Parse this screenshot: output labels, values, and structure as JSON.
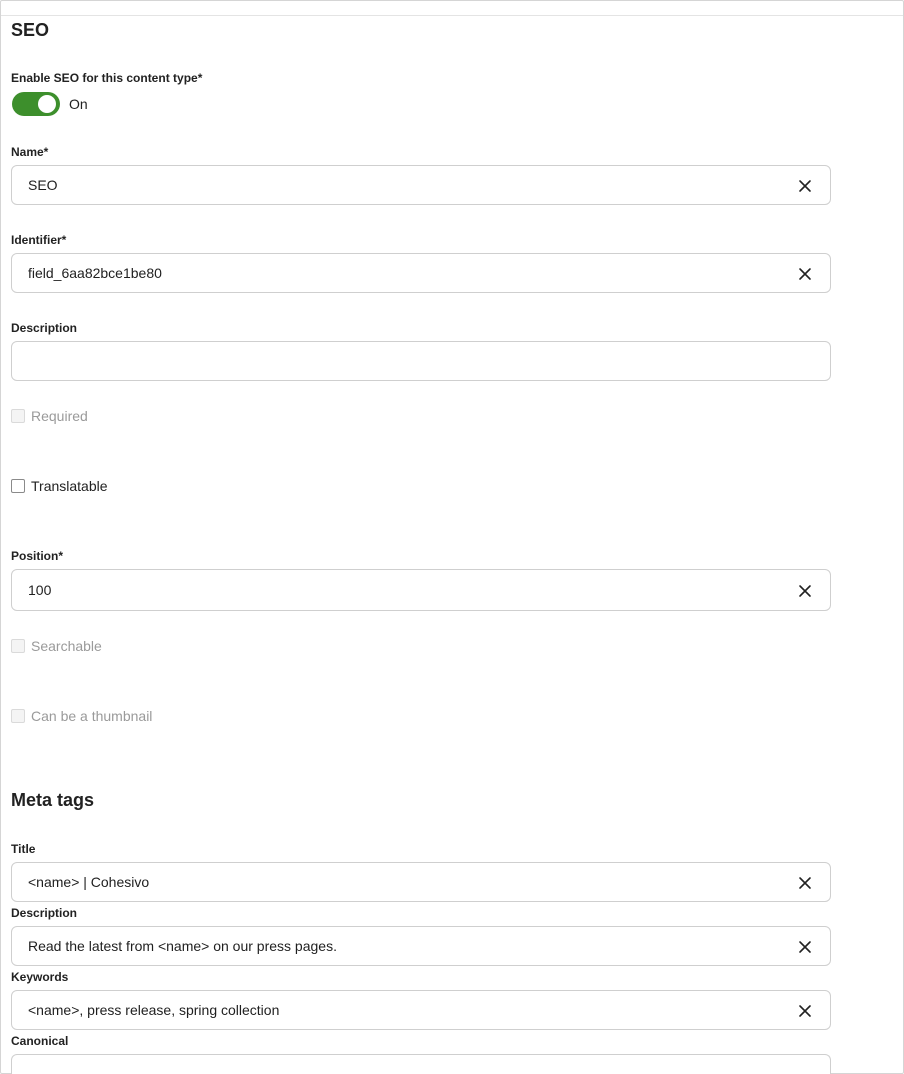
{
  "seo": {
    "title": "SEO",
    "enable_label": "Enable SEO for this content type*",
    "enable_state": "On"
  },
  "fields": {
    "name": {
      "label": "Name*",
      "value": "SEO"
    },
    "identifier": {
      "label": "Identifier*",
      "value": "field_6aa82bce1be80"
    },
    "description": {
      "label": "Description",
      "value": ""
    },
    "required": {
      "label": "Required",
      "checked": false,
      "disabled": true
    },
    "translatable": {
      "label": "Translatable",
      "checked": false,
      "disabled": false
    },
    "position": {
      "label": "Position*",
      "value": "100"
    },
    "searchable": {
      "label": "Searchable",
      "checked": false,
      "disabled": true
    },
    "thumbnail": {
      "label": "Can be a thumbnail",
      "checked": false,
      "disabled": true
    }
  },
  "meta": {
    "title": "Meta tags",
    "title_field": {
      "label": "Title",
      "value": "<name> | Cohesivo"
    },
    "description_field": {
      "label": "Description",
      "value": "Read the latest from <name> on our press pages."
    },
    "keywords_field": {
      "label": "Keywords",
      "value": "<name>, press release, spring collection"
    },
    "canonical_field": {
      "label": "Canonical",
      "value": ""
    }
  },
  "colors": {
    "toggle_on": "#3d8f2c",
    "border": "#cfcfcf"
  },
  "icons": {
    "clear": "close-icon"
  }
}
